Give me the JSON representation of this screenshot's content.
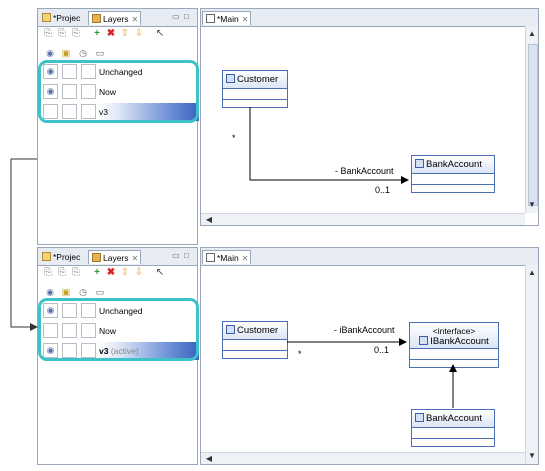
{
  "top": {
    "tabs": {
      "project": "*Projec",
      "layers": "Layers",
      "main": "*Main"
    },
    "layers": [
      {
        "label": "Unchanged",
        "visible": true,
        "selected": false
      },
      {
        "label": "Now",
        "visible": true,
        "selected": false
      },
      {
        "label": "v3",
        "visible": false,
        "selected": true
      }
    ],
    "diagram": {
      "customer": "Customer",
      "bank": "BankAccount",
      "assoc_role": "- BankAccount",
      "mult_source": "*",
      "mult_target": "0..1"
    }
  },
  "bottom": {
    "tabs": {
      "project": "*Projec",
      "layers": "Layers",
      "main": "*Main"
    },
    "layers": [
      {
        "label": "Unchanged",
        "visible": true,
        "selected": false
      },
      {
        "label": "Now",
        "visible": false,
        "selected": false
      },
      {
        "label": "v3",
        "suffix": "(active)",
        "visible": true,
        "selected": true
      }
    ],
    "diagram": {
      "customer": "Customer",
      "interface_stereotype": "<interface>",
      "interface_name": "IBankAccount",
      "bank": "BankAccount",
      "assoc_role": "- iBankAccount",
      "mult_source": "*",
      "mult_target": "0..1"
    }
  },
  "colors": {
    "highlight": "#3cc2c8",
    "selection": "#3a62bf",
    "uml_border": "#4a6fb2"
  },
  "icons": {
    "toolbar": [
      "new-layer-icon",
      "copy-layer-icon",
      "paste-layer-icon",
      "add-icon",
      "delete-icon",
      "move-up-icon",
      "move-down-icon",
      "select-icon"
    ],
    "columns": [
      "eye-icon",
      "lock-icon",
      "clock-icon",
      "folder-icon"
    ]
  }
}
